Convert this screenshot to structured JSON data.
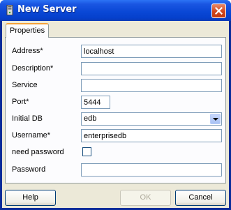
{
  "window": {
    "title": "New Server"
  },
  "tabs": [
    {
      "label": "Properties",
      "active": true
    }
  ],
  "form": {
    "address": {
      "label": "Address*",
      "value": "localhost"
    },
    "description": {
      "label": "Description*",
      "value": ""
    },
    "service": {
      "label": "Service",
      "value": ""
    },
    "port": {
      "label": "Port*",
      "value": "5444"
    },
    "initial_db": {
      "label": "Initial DB",
      "value": "edb"
    },
    "username": {
      "label": "Username*",
      "value": "enterprisedb"
    },
    "need_password": {
      "label": "need password",
      "checked": false
    },
    "password": {
      "label": "Password",
      "value": ""
    }
  },
  "buttons": {
    "help": "Help",
    "ok": "OK",
    "cancel": "Cancel"
  },
  "colors": {
    "titlebar": "#0a48d6",
    "dialog_bg": "#ece9d8",
    "close_button": "#d2461c"
  }
}
